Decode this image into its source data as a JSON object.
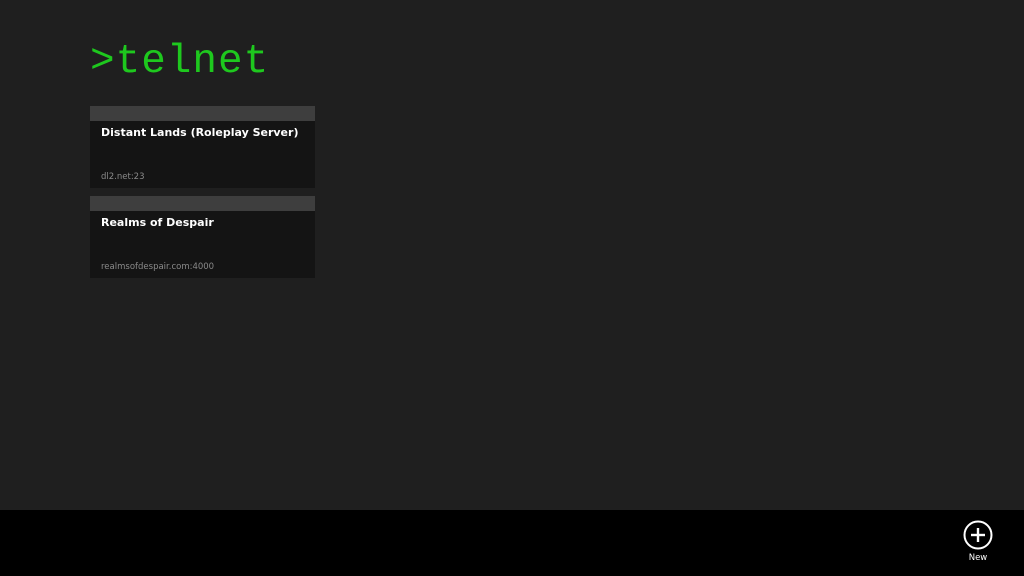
{
  "app": {
    "title": ">telnet",
    "accent_color": "#1ec81e"
  },
  "servers": [
    {
      "name": "Distant Lands (Roleplay Server)",
      "address": "dl2.net:23"
    },
    {
      "name": "Realms of Despair",
      "address": "realmsofdespair.com:4000"
    }
  ],
  "app_bar": {
    "new_label": "New",
    "new_icon": "plus-circle-icon"
  }
}
